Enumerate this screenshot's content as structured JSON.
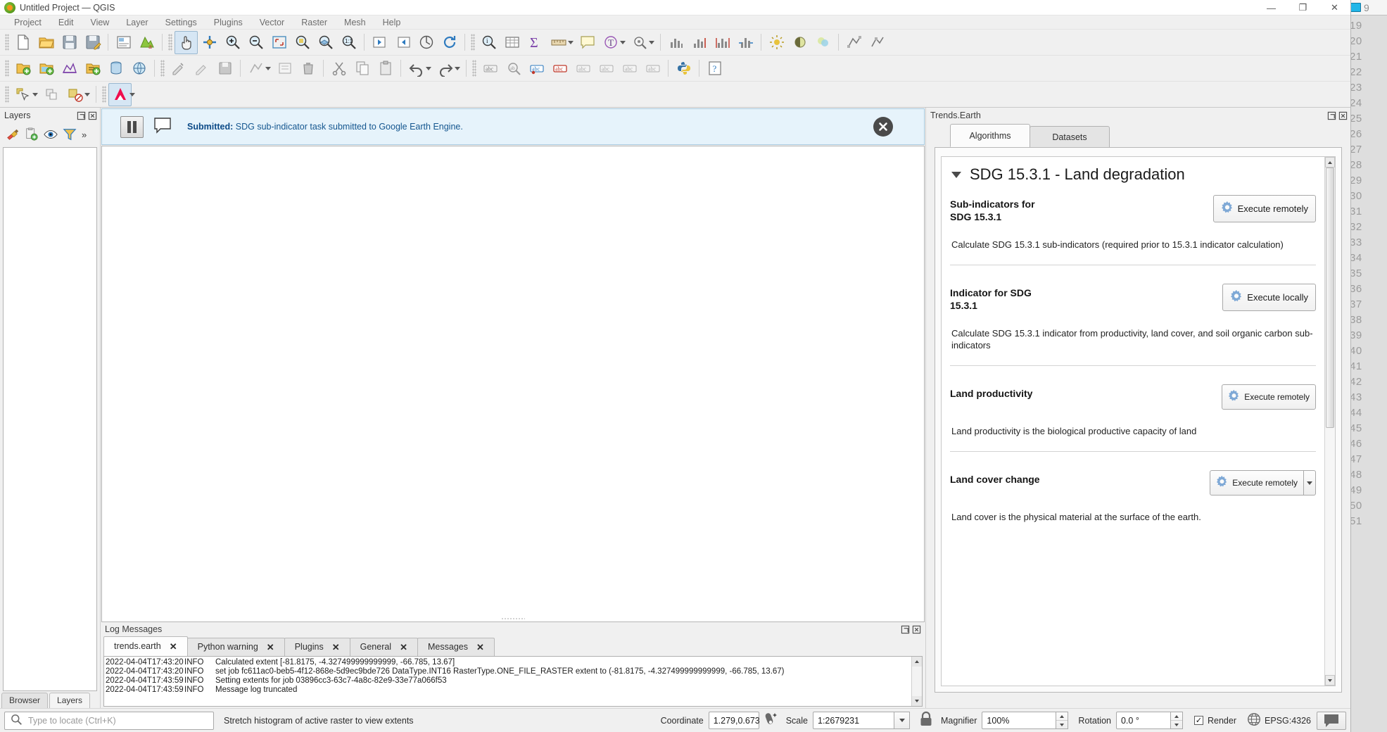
{
  "window": {
    "title": "Untitled Project — QGIS",
    "app_icon": "qgis-logo-icon",
    "minimize_label": "—",
    "maximize_label": "❐",
    "close_label": "✕"
  },
  "menubar": {
    "items": [
      {
        "label": "Project"
      },
      {
        "label": "Edit"
      },
      {
        "label": "View"
      },
      {
        "label": "Layer"
      },
      {
        "label": "Settings"
      },
      {
        "label": "Plugins"
      },
      {
        "label": "Vector"
      },
      {
        "label": "Raster"
      },
      {
        "label": "Mesh"
      },
      {
        "label": "Help"
      }
    ]
  },
  "toolbars": {
    "row1_icons": [
      "new-project-icon",
      "open-project-icon",
      "save-project-icon",
      "save-project-as-icon",
      "new-print-layout-icon",
      "style-manager-icon",
      "pan-map-icon",
      "pan-to-selection-icon",
      "zoom-in-icon",
      "zoom-out-icon",
      "zoom-full-icon",
      "zoom-to-selection-icon",
      "zoom-to-layer-icon",
      "zoom-native-icon",
      "zoom-last-icon",
      "zoom-next-icon",
      "refresh-icon",
      "identify-features-icon",
      "open-attribute-table-icon",
      "statistical-summary-icon",
      "measure-line-icon",
      "show-map-tips-icon",
      "show-spatial-bookmarks-icon",
      "new-text-annotation-icon",
      "histogram-icon",
      "histogram-stretch-icon",
      "histogram-stretch-full-icon",
      "histogram-stretch-local-icon",
      "raster-brightness-icon",
      "raster-contrast-icon",
      "raster-saturation-icon",
      "vertex-tool-icon",
      "vertex-tool-all-icon"
    ],
    "row2_icons": [
      "add-vector-layer-icon",
      "add-raster-layer-icon",
      "add-mesh-layer-icon",
      "add-delimited-text-layer-icon",
      "add-postgis-layer-icon",
      "add-wms-layer-icon",
      "toggle-editing-icon",
      "save-layer-edits-icon",
      "save-edits-icon",
      "add-feature-icon",
      "modify-attributes-icon",
      "delete-selected-icon",
      "cut-features-icon",
      "copy-features-icon",
      "paste-features-icon",
      "undo-icon",
      "redo-icon",
      "label-icon",
      "label-highlight-icon",
      "pin-labels-icon",
      "show-hide-labels-icon",
      "move-label-icon",
      "rotate-label-icon",
      "change-label-icon",
      "label-properties-icon",
      "python-console-icon",
      "help-icon"
    ],
    "row3_icons": [
      "select-features-icon",
      "deselect-features-icon",
      "select-by-expression-icon",
      "trends-earth-icon"
    ]
  },
  "layers_panel": {
    "title": "Layers",
    "dock_float_icon": "dock-float-icon",
    "dock_close_icon": "dock-close-icon",
    "tools": [
      {
        "name": "open-layer-styling-panel-icon"
      },
      {
        "name": "add-group-icon"
      },
      {
        "name": "manage-layer-visibility-icon"
      },
      {
        "name": "filter-legend-icon"
      },
      {
        "name": "expand-more-icon",
        "label": "»"
      }
    ],
    "tabs": [
      {
        "label": "Browser",
        "active": false
      },
      {
        "label": "Layers",
        "active": true
      }
    ]
  },
  "message_bar": {
    "pause_icon": "pause-icon",
    "comment_icon": "speech-bubble-icon",
    "level": "Submitted:",
    "text": " SDG sub-indicator task submitted to Google Earth Engine.",
    "close_icon": "close-circle-icon"
  },
  "log_dock": {
    "title": "Log Messages",
    "dock_float_icon": "dock-float-icon",
    "dock_close_icon": "dock-close-icon",
    "tabs": [
      {
        "label": "trends.earth",
        "active": true,
        "close": "✕"
      },
      {
        "label": "Python warning",
        "active": false,
        "close": "✕"
      },
      {
        "label": "Plugins",
        "active": false,
        "close": "✕"
      },
      {
        "label": "General",
        "active": false,
        "close": "✕"
      },
      {
        "label": "Messages",
        "active": false,
        "close": "✕"
      }
    ],
    "rows": [
      {
        "time": "2022-04-04T17:43:20",
        "level": "INFO",
        "message": "Calculated extent [-81.8175, -4.327499999999999, -66.785, 13.67]"
      },
      {
        "time": "2022-04-04T17:43:20",
        "level": "INFO",
        "message": "set job fc611ac0-beb5-4f12-868e-5d9ec9bde726 DataType.INT16 RasterType.ONE_FILE_RASTER extent to (-81.8175, -4.327499999999999, -66.785, 13.67)"
      },
      {
        "time": "2022-04-04T17:43:59",
        "level": "INFO",
        "message": "Setting extents for job 03896cc3-63c7-4a8c-82e9-33e77a066f53"
      },
      {
        "time": "2022-04-04T17:43:59",
        "level": "INFO",
        "message": "Message log truncated"
      }
    ]
  },
  "trends_earth": {
    "dock_title": "Trends.Earth",
    "dock_float_icon": "dock-float-icon",
    "dock_close_icon": "dock-close-icon",
    "tabs": [
      {
        "label": "Algorithms",
        "active": true
      },
      {
        "label": "Datasets",
        "active": false
      }
    ],
    "group": {
      "expander_icon": "triangle-down-icon",
      "title": "SDG 15.3.1 - Land degradation"
    },
    "algorithms": [
      {
        "name": "Sub-indicators for\nSDG 15.3.1",
        "name_line1": "Sub-indicators for",
        "name_line2": "SDG 15.3.1",
        "button": "Execute remotely",
        "button_icon": "gear-icon",
        "description": "Calculate SDG 15.3.1 sub-indicators (required prior to 15.3.1 indicator calculation)"
      },
      {
        "name_line1": "Indicator for SDG",
        "name_line2": "15.3.1",
        "button": "Execute locally",
        "button_icon": "gear-icon",
        "description": "Calculate SDG 15.3.1 indicator from productivity, land cover, and soil organic carbon sub-indicators"
      },
      {
        "name_line1": "Land productivity",
        "name_line2": "",
        "button": "Execute remotely",
        "button_icon": "gear-icon",
        "description": "Land productivity is the biological productive capacity of land"
      },
      {
        "name_line1": "Land cover change",
        "name_line2": "",
        "button": "Execute remotely",
        "button_icon": "gear-icon",
        "description": "Land cover is the physical material at the surface of the earth."
      }
    ],
    "scroll_up_icon": "scroll-up-icon",
    "scroll_down_icon": "scroll-down-icon"
  },
  "statusbar": {
    "locator_placeholder": "Type to locate (Ctrl+K)",
    "locator_icon": "search-icon",
    "status_message": "Stretch histogram of active raster to view extents",
    "coordinate_label": "Coordinate",
    "coordinate_value": "1.279,0.673",
    "coordinate_toggle_icon": "mouse-coordinate-icon",
    "scale_label": "Scale",
    "scale_value": "1:2679231",
    "lock_icon": "lock-scale-icon",
    "magnifier_label": "Magnifier",
    "magnifier_value": "100%",
    "rotation_label": "Rotation",
    "rotation_value": "0.0 °",
    "render_label": "Render",
    "render_checked": "✓",
    "crs_icon": "globe-icon",
    "crs_label": "EPSG:4326",
    "messages_icon": "message-log-icon"
  },
  "background_window": {
    "chip_icon": "window-chip-icon",
    "header_number": "9",
    "line_numbers": [
      "19",
      "20",
      "21",
      "22",
      "23",
      "24",
      "25",
      "26",
      "27",
      "28",
      "29",
      "30",
      "31",
      "32",
      "33",
      "34",
      "35",
      "36",
      "37",
      "38",
      "39",
      "40",
      "41",
      "42",
      "43",
      "44",
      "45",
      "46",
      "47",
      "48",
      "49",
      "50",
      "51"
    ]
  },
  "colors": {
    "message_bar_bg": "#e6f3fb",
    "message_bar_text": "#14568f",
    "gear_blue": "#6f9fd0",
    "accent_red": "#e8174a"
  }
}
